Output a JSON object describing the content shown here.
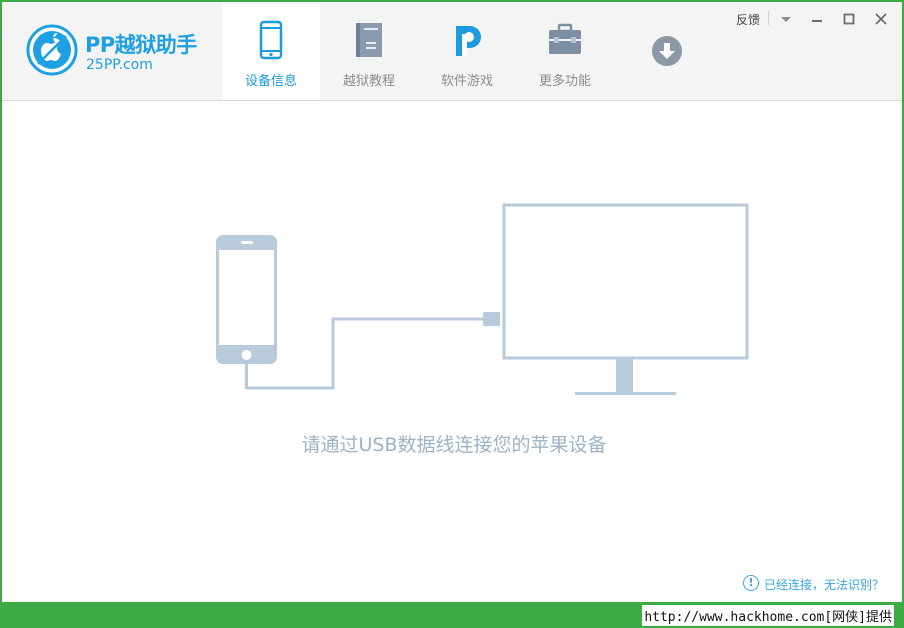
{
  "app": {
    "title": "PP越狱助手",
    "subtitle": "25PP.com",
    "brand_color": "#1fa0e2",
    "accent_green": "#3dab45"
  },
  "tabs": [
    {
      "label": "设备信息",
      "icon": "phone-icon",
      "active": true
    },
    {
      "label": "越狱教程",
      "icon": "book-icon",
      "active": false
    },
    {
      "label": "软件游戏",
      "icon": "pp-logo-icon",
      "active": false
    },
    {
      "label": "更多功能",
      "icon": "toolbox-icon",
      "active": false
    }
  ],
  "window_controls": {
    "feedback_label": "反馈",
    "menu_icon": "chevron-down-icon",
    "minimize_icon": "minimize-icon",
    "maximize_icon": "maximize-icon",
    "close_icon": "close-icon"
  },
  "main": {
    "prompt": "请通过USB数据线连接您的苹果设备",
    "help_link": "已经连接，无法识别？",
    "illustration_color": "#b9cbdb"
  },
  "footer": {
    "watermark": "http://www.hackhome.com[网侠]提供"
  }
}
